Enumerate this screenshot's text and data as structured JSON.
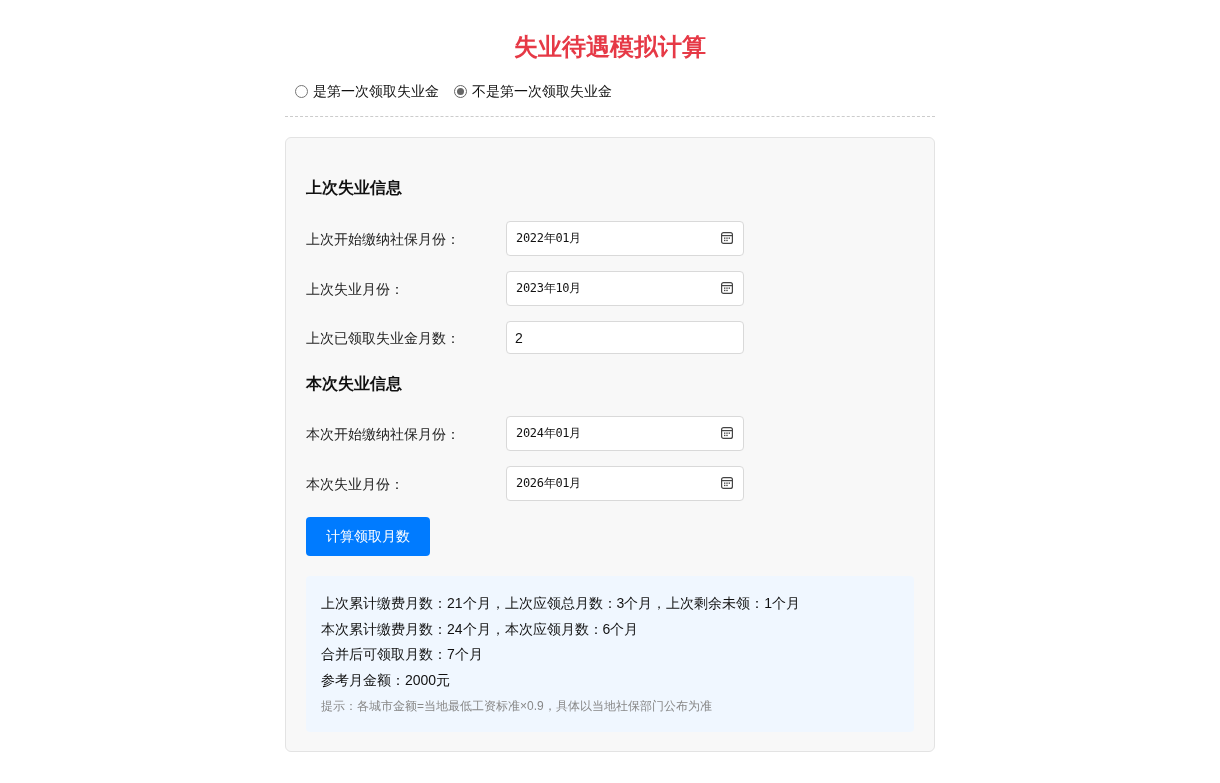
{
  "title": "失业待遇模拟计算",
  "first_time_options": [
    {
      "label": "是第一次领取失业金",
      "selected": false
    },
    {
      "label": "不是第一次领取失业金",
      "selected": true
    }
  ],
  "sections": [
    {
      "heading": "上次失业信息",
      "fields": [
        {
          "kind": "month",
          "label": "上次开始缴纳社保月份：",
          "value": "2022年01月"
        },
        {
          "kind": "month",
          "label": "上次失业月份：",
          "value": "2023年10月"
        },
        {
          "kind": "number",
          "label": "上次已领取失业金月数：",
          "value": "2"
        }
      ]
    },
    {
      "heading": "本次失业信息",
      "fields": [
        {
          "kind": "month",
          "label": "本次开始缴纳社保月份：",
          "value": "2024年01月"
        },
        {
          "kind": "month",
          "label": "本次失业月份：",
          "value": "2026年01月"
        }
      ]
    }
  ],
  "calculate_button": "计算领取月数",
  "results": {
    "lines": [
      "上次累计缴费月数：21个月，上次应领总月数：3个月，上次剩余未领：1个月",
      "本次累计缴费月数：24个月，本次应领月数：6个月",
      "合并后可领取月数：7个月",
      "参考月金额：2000元"
    ],
    "hint": "提示：各城市金额=当地最低工资标准×0.9，具体以当地社保部门公布为准"
  }
}
